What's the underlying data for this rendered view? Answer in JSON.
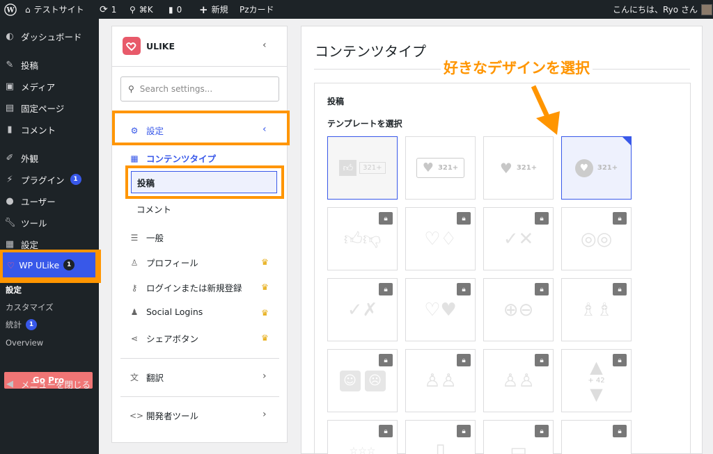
{
  "adminbar": {
    "site_name": "テストサイト",
    "updates_count": "1",
    "search_shortcut": "⌘K",
    "comments_count": "0",
    "new_label": "新規",
    "pz_label": "Pzカード",
    "greeting": "こんにちは、Ryo さん"
  },
  "sidebar": {
    "items": [
      {
        "label": "ダッシュボード",
        "icon": "dashboard-icon"
      },
      {
        "label": "投稿",
        "icon": "pin-icon"
      },
      {
        "label": "メディア",
        "icon": "media-icon"
      },
      {
        "label": "固定ページ",
        "icon": "page-icon"
      },
      {
        "label": "コメント",
        "icon": "comment-icon"
      },
      {
        "label": "外観",
        "icon": "brush-icon"
      },
      {
        "label": "プラグイン",
        "icon": "plugin-icon",
        "badge": "1"
      },
      {
        "label": "ユーザー",
        "icon": "user-icon"
      },
      {
        "label": "ツール",
        "icon": "wrench-icon"
      },
      {
        "label": "設定",
        "icon": "settings-icon"
      }
    ],
    "wpulike": {
      "label": "WP ULike",
      "badge": "1"
    },
    "submenu": {
      "settings": "設定",
      "customize": "カスタマイズ",
      "stats": "統計",
      "stats_badge": "1",
      "overview": "Overview",
      "gopro": "Go Pro"
    },
    "collapse": "メニューを閉じる"
  },
  "panel": {
    "logo": "ULIKE",
    "search_placeholder": "Search settings...",
    "settings_label": "設定",
    "content_types": "コンテンツタイプ",
    "posts": "投稿",
    "comments": "コメント",
    "general": "一般",
    "profile": "プロフィール",
    "login": "ログインまたは新規登録",
    "social_logins": "Social Logins",
    "share": "シェアボタン",
    "translate": "翻訳",
    "developer": "開発者ツール"
  },
  "content": {
    "title": "コンテンツタイプ",
    "annotation": "好きなデザインを選択",
    "section_title": "投稿",
    "template_label": "テンプレートを選択",
    "count_label": "321+",
    "counter_label": "+ 42"
  },
  "colors": {
    "accent": "#3858e9",
    "highlight": "#ff9500",
    "gopro": "#f07575"
  }
}
